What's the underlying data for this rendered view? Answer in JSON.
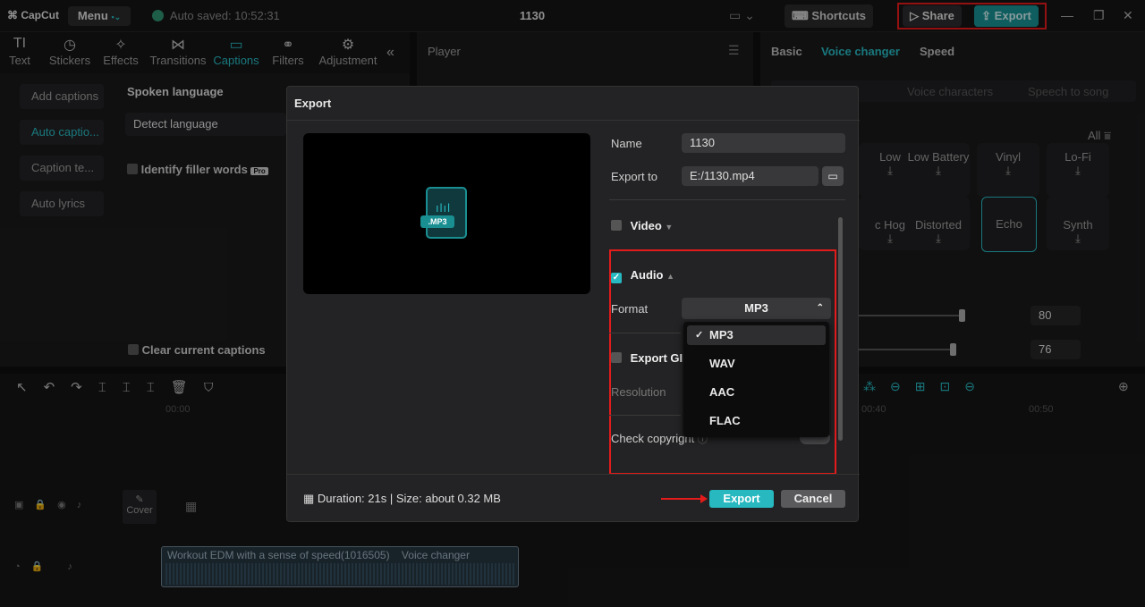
{
  "titlebar": {
    "app_name": "CapCut",
    "menu_label": "Menu",
    "autosave": "Auto saved: 10:52:31",
    "project_title": "1130",
    "shortcuts_label": "Shortcuts",
    "share_label": "Share",
    "export_label": "Export"
  },
  "tools": [
    {
      "label": "Text"
    },
    {
      "label": "Stickers"
    },
    {
      "label": "Effects"
    },
    {
      "label": "Transitions"
    },
    {
      "label": "Captions"
    },
    {
      "label": "Filters"
    },
    {
      "label": "Adjustment"
    }
  ],
  "captions_panel": {
    "items": [
      "Add captions",
      "Auto captio...",
      "Caption te...",
      "Auto lyrics"
    ],
    "spoken_language": "Spoken language",
    "detect_language": "Detect language",
    "identify_filler": "Identify filler words",
    "pro_badge": "Pro",
    "clear_captions": "Clear current captions"
  },
  "player": {
    "title": "Player"
  },
  "right_panel": {
    "tabs": [
      "Basic",
      "Voice changer",
      "Speed"
    ],
    "subtabs": [
      "Voice characters",
      "Speech to song"
    ],
    "all_label": "All",
    "voices": [
      "Low",
      "Low Battery",
      "Vinyl",
      "Lo-Fi",
      "c Hog",
      "Distorted",
      "Echo",
      "Synth"
    ],
    "slider_values": [
      "80",
      "76"
    ]
  },
  "timeline": {
    "time_marks": [
      "00:00",
      "00:40",
      "00:50"
    ],
    "cover_label": "Cover",
    "audio_clip": "Workout EDM with a sense of speed(1016505)",
    "audio_effect": "Voice changer"
  },
  "dialog": {
    "title": "Export",
    "file_badge": ".MP3",
    "name_label": "Name",
    "name_value": "1130",
    "export_to_label": "Export to",
    "export_to_value": "E:/1130.mp4",
    "video_label": "Video",
    "audio_label": "Audio",
    "format_label": "Format",
    "format_value": "MP3",
    "format_options": [
      "MP3",
      "WAV",
      "AAC",
      "FLAC"
    ],
    "export_gif_label": "Export GIF",
    "resolution_label": "Resolution",
    "check_copyright_label": "Check copyright",
    "footer_info": "Duration: 21s | Size: about 0.32 MB",
    "export_button": "Export",
    "cancel_button": "Cancel"
  },
  "colors": {
    "accent": "#27b8c0",
    "highlight_red": "#e31b1b"
  }
}
